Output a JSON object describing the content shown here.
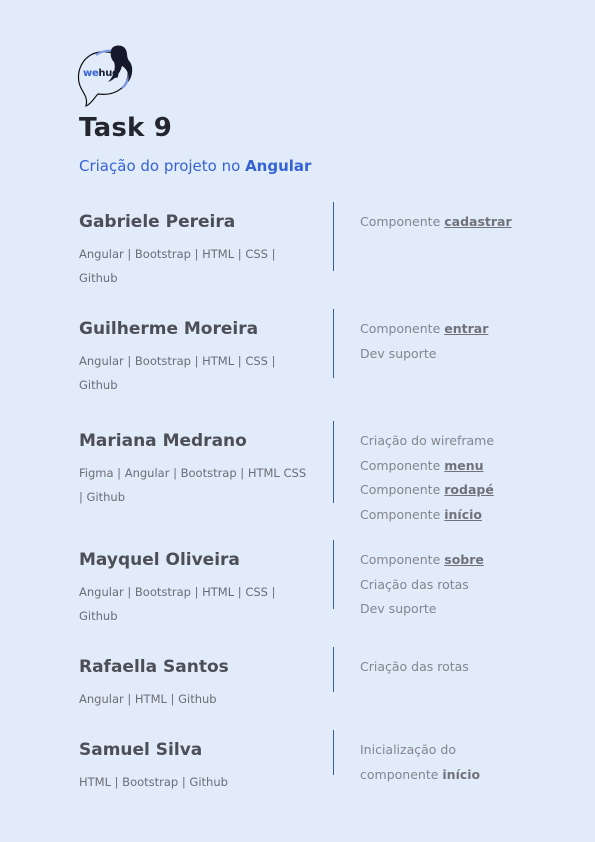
{
  "logo": {
    "part1": "we",
    "part2": "hug"
  },
  "header": {
    "title": "Task 9",
    "subtitle_prefix": "Criação do projeto no ",
    "subtitle_strong": "Angular"
  },
  "members": [
    {
      "name": "Gabriele Pereira",
      "skills": "Angular | Bootstrap | HTML | CSS | Github",
      "tasks": [
        {
          "text": "Componente ",
          "emph": "cadastrar"
        }
      ]
    },
    {
      "name": "Guilherme Moreira",
      "skills": "Angular | Bootstrap | HTML | CSS | Github",
      "tasks": [
        {
          "text": "Componente ",
          "emph": "entrar"
        },
        {
          "text": "Dev suporte",
          "emph": ""
        }
      ]
    },
    {
      "name": "Mariana Medrano",
      "skills": "Figma | Angular | Bootstrap | HTML CSS | Github",
      "tasks": [
        {
          "text": "Criação do wireframe",
          "emph": ""
        },
        {
          "text": "Componente ",
          "emph": "menu"
        },
        {
          "text": "Componente ",
          "emph": "rodapé"
        },
        {
          "text": "Componente ",
          "emph": "início"
        }
      ]
    },
    {
      "name": "Mayquel Oliveira",
      "skills": "Angular | Bootstrap | HTML | CSS | Github",
      "tasks": [
        {
          "text": "Componente ",
          "emph": "sobre"
        },
        {
          "text": "Criação das rotas",
          "emph": ""
        },
        {
          "text": "Dev suporte",
          "emph": ""
        }
      ]
    },
    {
      "name": "Rafaella Santos",
      "skills": "Angular | HTML | Github",
      "tasks": [
        {
          "text": "Criação das rotas",
          "emph": ""
        }
      ]
    },
    {
      "name": "Samuel Silva",
      "skills": "HTML | Bootstrap | Github",
      "tasks": [
        {
          "text": "Inicialização do",
          "emph": ""
        },
        {
          "text": "componente ",
          "emph": "início",
          "plain_bold": true
        }
      ]
    }
  ],
  "colors": {
    "background": "#e2ebf9",
    "accent": "#3563d6",
    "divider": "#3a5da6"
  }
}
